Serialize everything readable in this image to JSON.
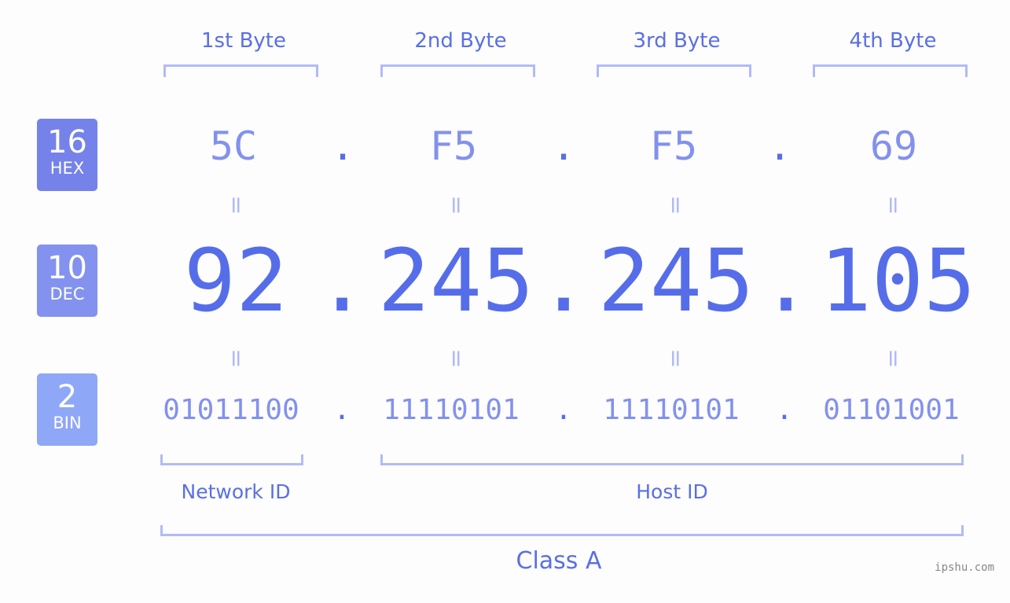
{
  "bytes": [
    {
      "label": "1st Byte",
      "hex": "5C",
      "dec": "92",
      "bin": "01011100"
    },
    {
      "label": "2nd Byte",
      "hex": "F5",
      "dec": "245",
      "bin": "11110101"
    },
    {
      "label": "3rd Byte",
      "hex": "F5",
      "dec": "245",
      "bin": "11110101"
    },
    {
      "label": "4th Byte",
      "hex": "69",
      "dec": "105",
      "bin": "01101001"
    }
  ],
  "separator": ".",
  "equals": "=",
  "badges": {
    "hex": {
      "num": "16",
      "label": "HEX",
      "color": "#7482ea"
    },
    "dec": {
      "num": "10",
      "label": "DEC",
      "color": "#8392ef"
    },
    "bin": {
      "num": "2",
      "label": "BIN",
      "color": "#8fa7f7"
    }
  },
  "groups": {
    "network": "Network ID",
    "host": "Host ID",
    "class": "Class A"
  },
  "watermark": "ipshu.com"
}
